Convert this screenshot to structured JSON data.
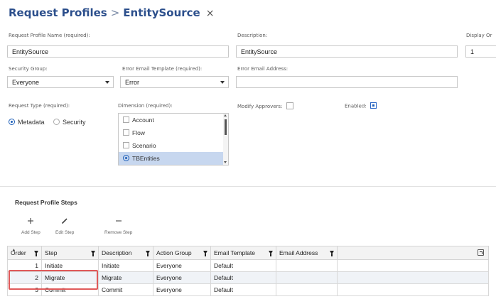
{
  "header": {
    "breadcrumb_root": "Request Profiles",
    "separator": ">",
    "current": "EntitySource",
    "close_glyph": "×"
  },
  "form": {
    "name": {
      "label": "Request Profile Name (required):",
      "value": "EntitySource"
    },
    "description": {
      "label": "Description:",
      "value": "EntitySource"
    },
    "display_order": {
      "label": "Display Or",
      "value": "1"
    },
    "security_group": {
      "label": "Security Group:",
      "value": "Everyone"
    },
    "error_email_template": {
      "label": "Error Email Template (required):",
      "value": "Error"
    },
    "error_email_address": {
      "label": "Error Email Address:",
      "value": ""
    },
    "request_type": {
      "label": "Request Type (required):",
      "options": [
        {
          "label": "Metadata",
          "selected": true
        },
        {
          "label": "Security",
          "selected": false
        }
      ]
    },
    "dimension": {
      "label": "Dimension (required):",
      "items": [
        {
          "label": "Account",
          "selected": false
        },
        {
          "label": "Flow",
          "selected": false
        },
        {
          "label": "Scenario",
          "selected": false
        },
        {
          "label": "TBEntities",
          "selected": true
        }
      ]
    },
    "modify_approvers": {
      "label": "Modify Approvers:",
      "checked": false
    },
    "enabled": {
      "label": "Enabled:",
      "checked": true
    }
  },
  "steps": {
    "title": "Request Profile Steps",
    "toolbar": {
      "add": {
        "label": "Add Step",
        "icon": "plus-icon"
      },
      "edit": {
        "label": "Edit Step",
        "icon": "pencil-icon"
      },
      "remove": {
        "label": "Remove Step",
        "icon": "minus-icon"
      }
    },
    "columns": [
      "Order",
      "Step",
      "Description",
      "Action Group",
      "Email Template",
      "Email Address"
    ],
    "rows": [
      {
        "order": "1",
        "step": "Initiate",
        "description": "Initiate",
        "action_group": "Everyone",
        "email_template": "Default",
        "email_address": ""
      },
      {
        "order": "2",
        "step": "Migrate",
        "description": "Migrate",
        "action_group": "Everyone",
        "email_template": "Default",
        "email_address": ""
      },
      {
        "order": "3",
        "step": "Commit",
        "description": "Commit",
        "action_group": "Everyone",
        "email_template": "Default",
        "email_address": ""
      }
    ]
  },
  "colors": {
    "title": "#2c4f8c",
    "accent": "#1e5fb8",
    "highlight": "#e05a5a"
  }
}
